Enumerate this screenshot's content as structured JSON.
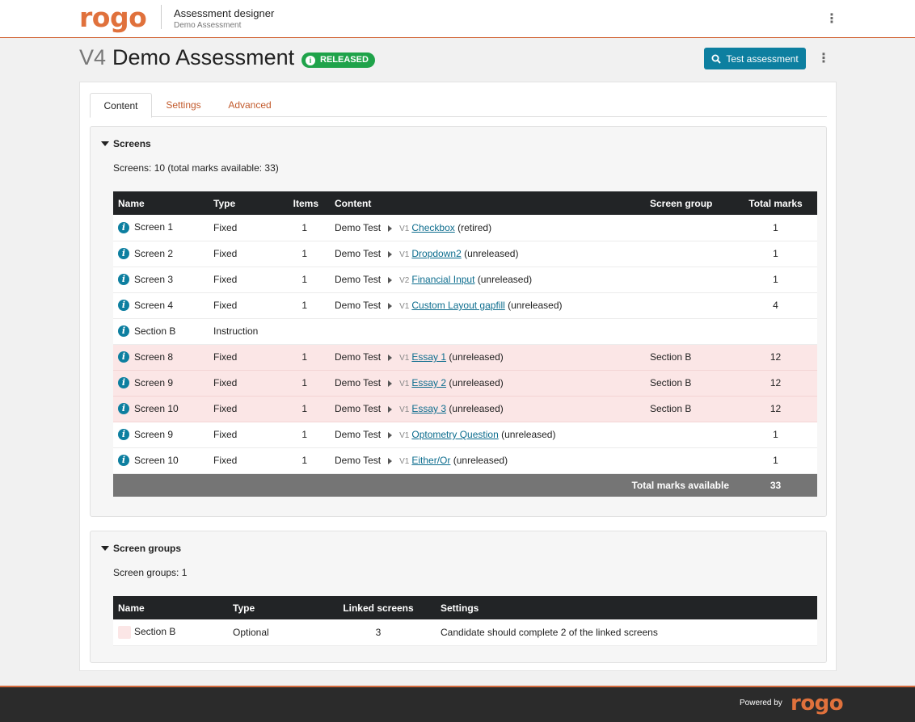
{
  "brand": {
    "logo_text": "rogo",
    "color": "#e0713c"
  },
  "header": {
    "app_title": "Assessment designer",
    "app_subtitle": "Demo Assessment",
    "menu_icon": "kebab-icon"
  },
  "page": {
    "version": "V4",
    "title": "Demo Assessment",
    "status": "RELEASED",
    "status_color": "#1fa34a",
    "test_button": "Test assessment",
    "accent": "#0d7fa0"
  },
  "tabs": [
    {
      "label": "Content",
      "active": true
    },
    {
      "label": "Settings",
      "active": false
    },
    {
      "label": "Advanced",
      "active": false
    }
  ],
  "screens": {
    "heading": "Screens",
    "summary": "Screens: 10 (total marks available: 33)",
    "columns": [
      "Name",
      "Type",
      "Items",
      "Content",
      "Screen group",
      "Total marks"
    ],
    "rows": [
      {
        "name": "Screen 1",
        "type": "Fixed",
        "items": "1",
        "content_prefix": "Demo Test",
        "version": "V1",
        "link": "Checkbox",
        "state": "(retired)",
        "group": "",
        "marks": "1",
        "grouped": false
      },
      {
        "name": "Screen 2",
        "type": "Fixed",
        "items": "1",
        "content_prefix": "Demo Test",
        "version": "V1",
        "link": "Dropdown2",
        "state": "(unreleased)",
        "group": "",
        "marks": "1",
        "grouped": false
      },
      {
        "name": "Screen 3",
        "type": "Fixed",
        "items": "1",
        "content_prefix": "Demo Test",
        "version": "V2",
        "link": "Financial Input",
        "state": "(unreleased)",
        "group": "",
        "marks": "1",
        "grouped": false
      },
      {
        "name": "Screen 4",
        "type": "Fixed",
        "items": "1",
        "content_prefix": "Demo Test",
        "version": "V1",
        "link": "Custom Layout gapfill",
        "state": "(unreleased)",
        "group": "",
        "marks": "4",
        "grouped": false
      },
      {
        "name": "Section B",
        "type": "Instruction",
        "items": "",
        "content_prefix": "",
        "version": "",
        "link": "",
        "state": "",
        "group": "",
        "marks": "",
        "grouped": false
      },
      {
        "name": "Screen 8",
        "type": "Fixed",
        "items": "1",
        "content_prefix": "Demo Test",
        "version": "V1",
        "link": "Essay 1",
        "state": "(unreleased)",
        "group": "Section B",
        "marks": "12",
        "grouped": true
      },
      {
        "name": "Screen 9",
        "type": "Fixed",
        "items": "1",
        "content_prefix": "Demo Test",
        "version": "V1",
        "link": "Essay 2",
        "state": "(unreleased)",
        "group": "Section B",
        "marks": "12",
        "grouped": true
      },
      {
        "name": "Screen 10",
        "type": "Fixed",
        "items": "1",
        "content_prefix": "Demo Test",
        "version": "V1",
        "link": "Essay 3",
        "state": "(unreleased)",
        "group": "Section B",
        "marks": "12",
        "grouped": true
      },
      {
        "name": "Screen 9",
        "type": "Fixed",
        "items": "1",
        "content_prefix": "Demo Test",
        "version": "V1",
        "link": "Optometry Question",
        "state": "(unreleased)",
        "group": "",
        "marks": "1",
        "grouped": false
      },
      {
        "name": "Screen 10",
        "type": "Fixed",
        "items": "1",
        "content_prefix": "Demo Test",
        "version": "V1",
        "link": "Either/Or",
        "state": "(unreleased)",
        "group": "",
        "marks": "1",
        "grouped": false
      }
    ],
    "total_label": "Total marks available",
    "total_value": "33"
  },
  "screen_groups": {
    "heading": "Screen groups",
    "summary": "Screen groups: 1",
    "columns": [
      "Name",
      "Type",
      "Linked screens",
      "Settings"
    ],
    "rows": [
      {
        "name": "Section B",
        "type": "Optional",
        "linked": "3",
        "settings": "Candidate should complete 2 of the linked screens",
        "swatch_color": "#fbe6e6"
      }
    ]
  },
  "footer": {
    "powered_by": "Powered by",
    "logo_text": "rogo"
  }
}
